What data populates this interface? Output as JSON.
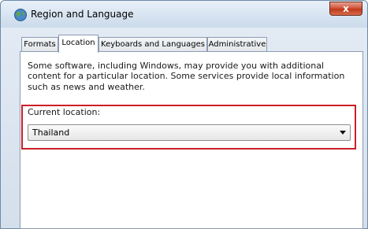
{
  "window": {
    "title": "Region and Language",
    "close_label": "x"
  },
  "tabs": [
    {
      "label": "Formats"
    },
    {
      "label": "Location"
    },
    {
      "label": "Keyboards and Languages"
    },
    {
      "label": "Administrative"
    }
  ],
  "active_tab": "Location",
  "location": {
    "description": "Some software, including Windows, may provide you with additional content for a particular location. Some services provide local information such as news and weather.",
    "current_label": "Current location:",
    "selected_value": "Thailand"
  },
  "colors": {
    "highlight": "#cc1f26"
  }
}
